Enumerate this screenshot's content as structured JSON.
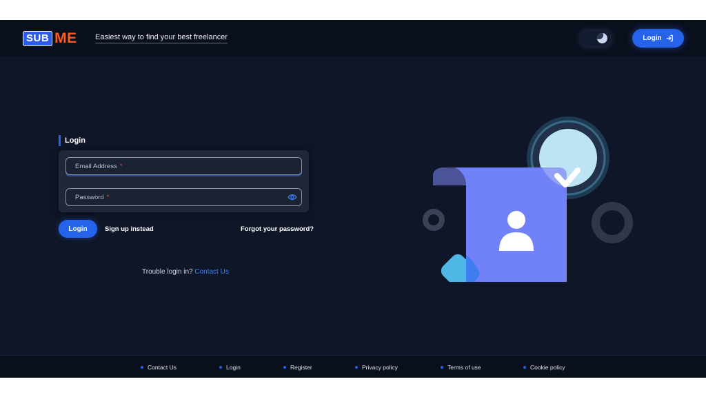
{
  "header": {
    "logo_sub": "SUB",
    "logo_me": "ME",
    "tagline": "Easiest way to find your best freelancer",
    "login_label": "Login"
  },
  "form": {
    "title": "Login",
    "email_placeholder": "Email Address",
    "password_placeholder": "Password",
    "required_mark": "*",
    "login_button": "Login",
    "signup_link": "Sign up instead",
    "forgot_link": "Forgot your password?",
    "trouble_text": "Trouble login in?",
    "contact_link": "Contact Us"
  },
  "footer": {
    "links": [
      "Contact Us",
      "Login",
      "Register",
      "Privacy policy",
      "Terms of use",
      "Cookie policy"
    ]
  },
  "colors": {
    "background": "#0f1627",
    "header_bg": "#0a0f1c",
    "accent": "#2563eb",
    "logo_orange": "#ff5a1f",
    "illustration_doc": "#7181f7",
    "illustration_check": "#bde4f4"
  },
  "icons": {
    "theme_toggle": "moon-icon",
    "login_button": "login-arrow-icon",
    "password_field": "eye-icon",
    "illustration": "user-document-check-illustration"
  }
}
